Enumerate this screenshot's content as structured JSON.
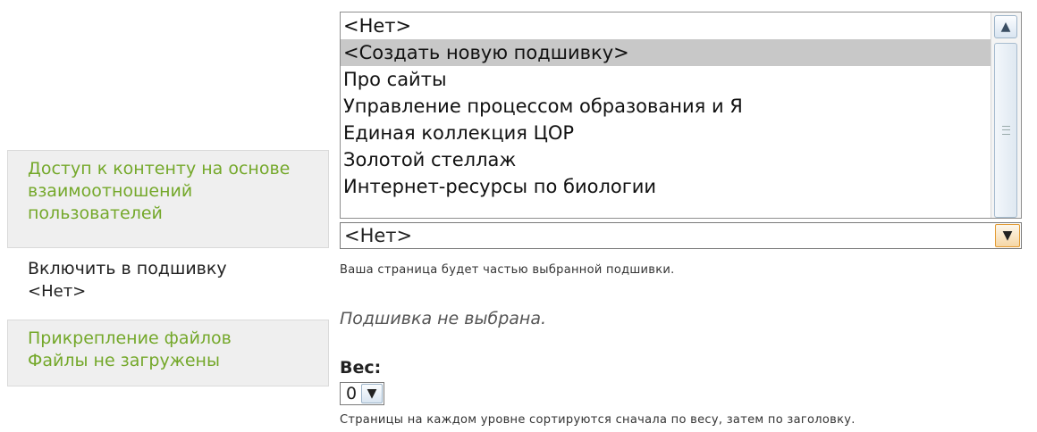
{
  "tabs": [
    {
      "title": "Доступ к контенту на основе взаимоотношений пользователей",
      "subtitle": ""
    },
    {
      "title": "Включить в подшивку",
      "subtitle": "<Нет>"
    },
    {
      "title": "Прикрепление файлов",
      "subtitle": "Файлы не загружены"
    }
  ],
  "book_list": {
    "options": [
      "<Нет>",
      "<Создать новую подшивку>",
      "Про сайты",
      "Управление процессом образования и Я",
      "Единая коллекция ЦОР",
      "Золотой стеллаж",
      "Интернет-ресурсы по биологии"
    ],
    "selected_index": 1
  },
  "book_select": {
    "value": "<Нет>",
    "description": "Ваша страница будет частью выбранной подшивки."
  },
  "no_book_text": "Подшивка не выбрана.",
  "weight": {
    "label": "Вес:",
    "value": "0",
    "description": "Страницы на каждом уровне сортируются сначала по весу, затем по заголовку."
  },
  "colors": {
    "green_link": "#74a82a",
    "selected_option": "#c8c8c8",
    "dropdown_accent": "#e29a31"
  },
  "icons": {
    "up_arrow": "scroll-up-icon",
    "dropdown": "chevron-down-icon"
  }
}
